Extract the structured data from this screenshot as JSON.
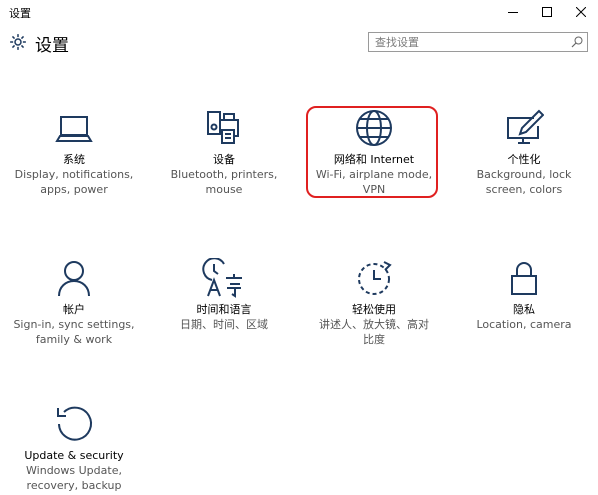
{
  "window": {
    "title": "设置"
  },
  "header": {
    "title": "设置",
    "search_placeholder": "查找设置"
  },
  "tiles": [
    {
      "label": "系统",
      "desc1": "Display, notifications,",
      "desc2": "apps, power"
    },
    {
      "label": "设备",
      "desc1": "Bluetooth, printers,",
      "desc2": "mouse"
    },
    {
      "label": "网络和 Internet",
      "desc1": "Wi-Fi, airplane mode,",
      "desc2": "VPN"
    },
    {
      "label": "个性化",
      "desc1": "Background, lock",
      "desc2": "screen, colors"
    },
    {
      "label": "帐户",
      "desc1": "Sign-in, sync settings,",
      "desc2": "family & work"
    },
    {
      "label": "时间和语言",
      "desc1": "日期、时间、区域",
      "desc2": ""
    },
    {
      "label": "轻松使用",
      "desc1": "讲述人、放大镜、高对",
      "desc2": "比度"
    },
    {
      "label": "隐私",
      "desc1": "Location, camera",
      "desc2": ""
    },
    {
      "label": "Update & security",
      "desc1": "Windows Update,",
      "desc2": "recovery, backup"
    }
  ],
  "colors": {
    "icon": "#1e3a5f",
    "highlight": "#e02020"
  }
}
